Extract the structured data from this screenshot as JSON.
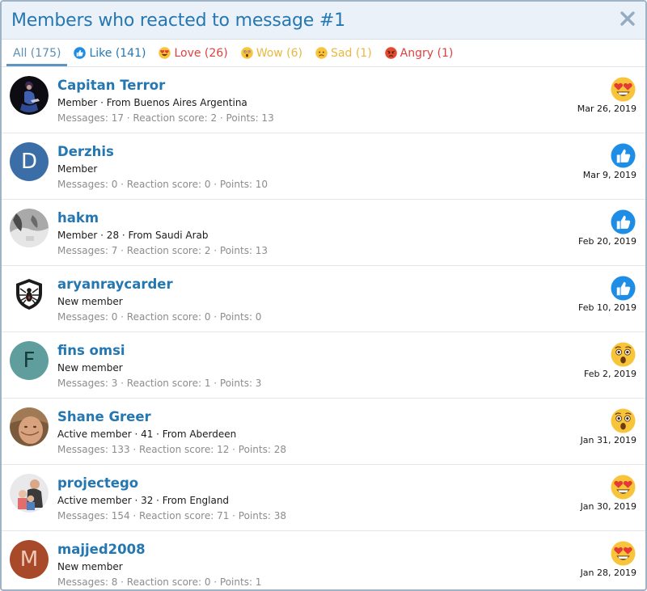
{
  "dialog": {
    "title": "Members who reacted to message #1"
  },
  "tabs": [
    {
      "label": "All (175)",
      "type": "all"
    },
    {
      "label": "Like (141)",
      "type": "like"
    },
    {
      "label": "Love (26)",
      "type": "love"
    },
    {
      "label": "Wow (6)",
      "type": "wow"
    },
    {
      "label": "Sad (1)",
      "type": "sad"
    },
    {
      "label": "Angry (1)",
      "type": "angry"
    }
  ],
  "members": [
    {
      "name": "Capitan Terror",
      "meta": "Member · From Buenos Aires Argentina",
      "stats": "Messages: 17 · Reaction score: 2 · Points: 13",
      "reaction": "love",
      "date": "Mar 26, 2019",
      "avatar": "photo"
    },
    {
      "name": "Derzhis",
      "meta": "Member",
      "stats": "Messages: 0 · Reaction score: 0 · Points: 10",
      "reaction": "like",
      "date": "Mar 9, 2019",
      "avatar": "D",
      "avatar_color": "#3b6ea6"
    },
    {
      "name": "hakm",
      "meta": "Member · 28 · From Saudi Arab",
      "stats": "Messages: 7 · Reaction score: 2 · Points: 13",
      "reaction": "like",
      "date": "Feb 20, 2019",
      "avatar": "photo"
    },
    {
      "name": "aryanraycarder",
      "meta": "New member",
      "stats": "Messages: 0 · Reaction score: 0 · Points: 0",
      "reaction": "like",
      "date": "Feb 10, 2019",
      "avatar": "photo"
    },
    {
      "name": "fins omsi",
      "meta": "New member",
      "stats": "Messages: 3 · Reaction score: 1 · Points: 3",
      "reaction": "wow",
      "date": "Feb 2, 2019",
      "avatar": "F",
      "avatar_color": "#5f9e9d"
    },
    {
      "name": "Shane Greer",
      "meta": "Active member · 41 · From Aberdeen",
      "stats": "Messages: 133 · Reaction score: 12 · Points: 28",
      "reaction": "wow",
      "date": "Jan 31, 2019",
      "avatar": "photo"
    },
    {
      "name": "projectego",
      "meta": "Active member · 32 · From England",
      "stats": "Messages: 154 · Reaction score: 71 · Points: 38",
      "reaction": "love",
      "date": "Jan 30, 2019",
      "avatar": "photo"
    },
    {
      "name": "majjed2008",
      "meta": "New member",
      "stats": "Messages: 8 · Reaction score: 0 · Points: 1",
      "reaction": "love",
      "date": "Jan 28, 2019",
      "avatar": "M",
      "avatar_color": "#a84a2a"
    }
  ]
}
